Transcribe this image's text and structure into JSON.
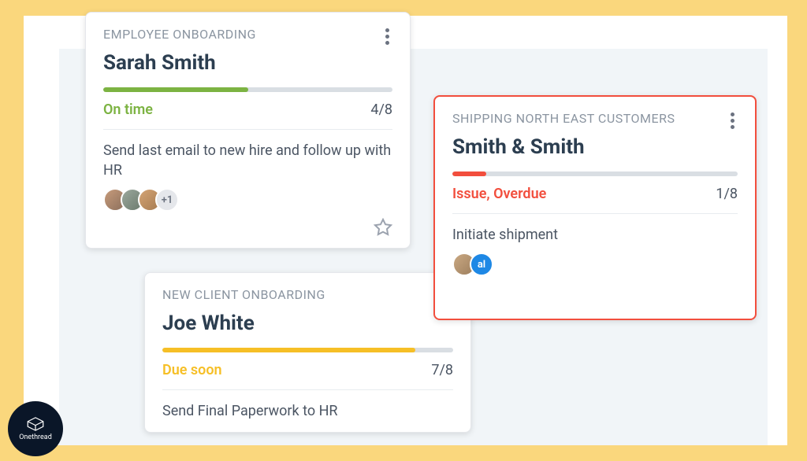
{
  "cards": [
    {
      "category": "EMPLOYEE ONBOARDING",
      "title": "Sarah Smith",
      "status": "On time",
      "count": "4/8",
      "task": "Send last email to new hire and follow up with HR",
      "more_count": "+1"
    },
    {
      "category": "NEW CLIENT ONBOARDING",
      "title": "Joe White",
      "status": "Due soon",
      "count": "7/8",
      "task": "Send Final Paperwork to HR"
    },
    {
      "category": "SHIPPING NORTH EAST CUSTOMERS",
      "title": "Smith & Smith",
      "status": "Issue, Overdue",
      "count": "1/8",
      "task": "Initiate shipment",
      "badge": "al"
    }
  ],
  "logo": {
    "name": "Onethread"
  }
}
